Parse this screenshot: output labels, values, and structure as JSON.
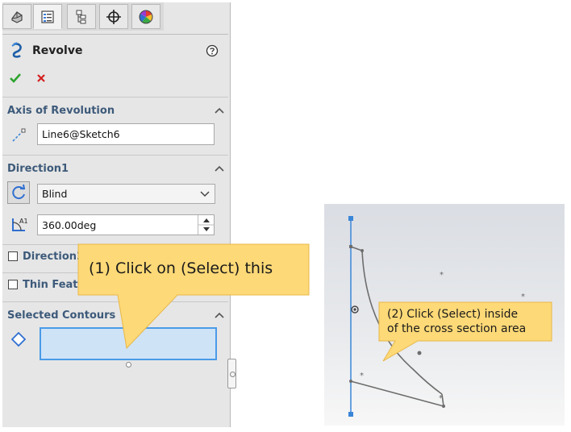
{
  "panel": {
    "tabs": [
      {
        "name": "feature-manager-tab",
        "icon": "feature-tree-icon"
      },
      {
        "name": "property-manager-tab",
        "icon": "property-manager-icon"
      },
      {
        "name": "configuration-manager-tab",
        "icon": "configuration-manager-icon"
      },
      {
        "name": "dimxpert-tab",
        "icon": "crosshair-icon"
      },
      {
        "name": "display-manager-tab",
        "icon": "color-wheel-icon"
      }
    ],
    "title": "Revolve",
    "help_icon": "help-icon",
    "ok_icon": "green-check-icon",
    "cancel_icon": "red-x-icon",
    "axis_section": {
      "title": "Axis of Revolution",
      "value": "Line6@Sketch6"
    },
    "direction1": {
      "title": "Direction1",
      "type_selected": "Blind",
      "angle": "360.00deg"
    },
    "direction2": {
      "label": "Direction2",
      "checked": false
    },
    "thin_feature": {
      "label": "Thin Featu",
      "checked": false
    },
    "selected_contours": {
      "title": "Selected Contours",
      "value": ""
    }
  },
  "callouts": {
    "callout1": "(1) Click on (Select) this",
    "callout2_line1": "(2) Click (Select) inside",
    "callout2_line2": "of the cross section area"
  },
  "colors": {
    "panel_bg": "#e6e6e6",
    "section_title": "#3d5a7a",
    "callout_fill": "#fdd977",
    "selection_box": "#cfe3f7",
    "selection_border": "#4a9be8",
    "axis_line": "#3b86d8"
  }
}
